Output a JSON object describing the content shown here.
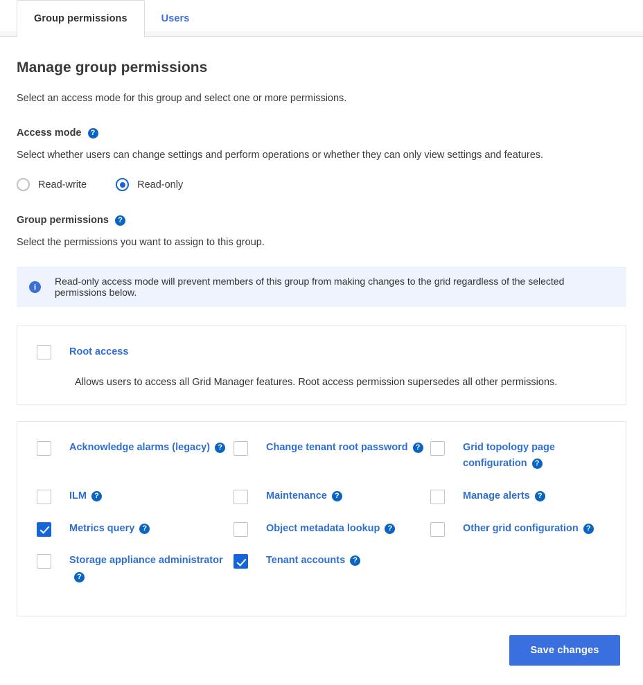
{
  "tabs": [
    {
      "label": "Group permissions",
      "active": true
    },
    {
      "label": "Users",
      "active": false
    }
  ],
  "page": {
    "title": "Manage group permissions",
    "intro": "Select an access mode for this group and select one or more permissions."
  },
  "access_mode": {
    "label": "Access mode",
    "help_icon": "help-icon",
    "description": "Select whether users can change settings and perform operations or whether they can only view settings and features.",
    "options": [
      {
        "label": "Read-write",
        "selected": false
      },
      {
        "label": "Read-only",
        "selected": true
      }
    ],
    "selected_value": "Read-only"
  },
  "group_permissions": {
    "label": "Group permissions",
    "help_icon": "help-icon",
    "description": "Select the permissions you want to assign to this group.",
    "notice": {
      "icon": "info-icon",
      "text": "Read-only access mode will prevent members of this group from making changes to the grid regardless of the selected permissions below."
    },
    "root": {
      "label": "Root access",
      "checked": false,
      "description": "Allows users to access all Grid Manager features. Root access permission supersedes all other permissions."
    },
    "items": [
      {
        "label": "Acknowledge alarms (legacy)",
        "checked": false,
        "help_icon": "help-icon"
      },
      {
        "label": "Change tenant root password",
        "checked": false,
        "help_icon": "help-icon"
      },
      {
        "label": "Grid topology page configuration",
        "checked": false,
        "help_icon": "help-icon"
      },
      {
        "label": "ILM",
        "checked": false,
        "help_icon": "help-icon"
      },
      {
        "label": "Maintenance",
        "checked": false,
        "help_icon": "help-icon"
      },
      {
        "label": "Manage alerts",
        "checked": false,
        "help_icon": "help-icon"
      },
      {
        "label": "Metrics query",
        "checked": true,
        "help_icon": "help-icon"
      },
      {
        "label": "Object metadata lookup",
        "checked": false,
        "help_icon": "help-icon"
      },
      {
        "label": "Other grid configuration",
        "checked": false,
        "help_icon": "help-icon"
      },
      {
        "label": "Storage appliance administrator",
        "checked": false,
        "help_icon": "help-icon"
      },
      {
        "label": "Tenant accounts",
        "checked": true,
        "help_icon": "help-icon"
      }
    ]
  },
  "footer": {
    "save_label": "Save changes"
  },
  "colors": {
    "accent": "#3a6fe0",
    "link": "#2f6fd0",
    "checked": "#1565d8",
    "banner_bg": "#eef3fd",
    "panel_border": "#e4e4e4"
  },
  "glyphs": {
    "help": "?",
    "info": "i"
  }
}
